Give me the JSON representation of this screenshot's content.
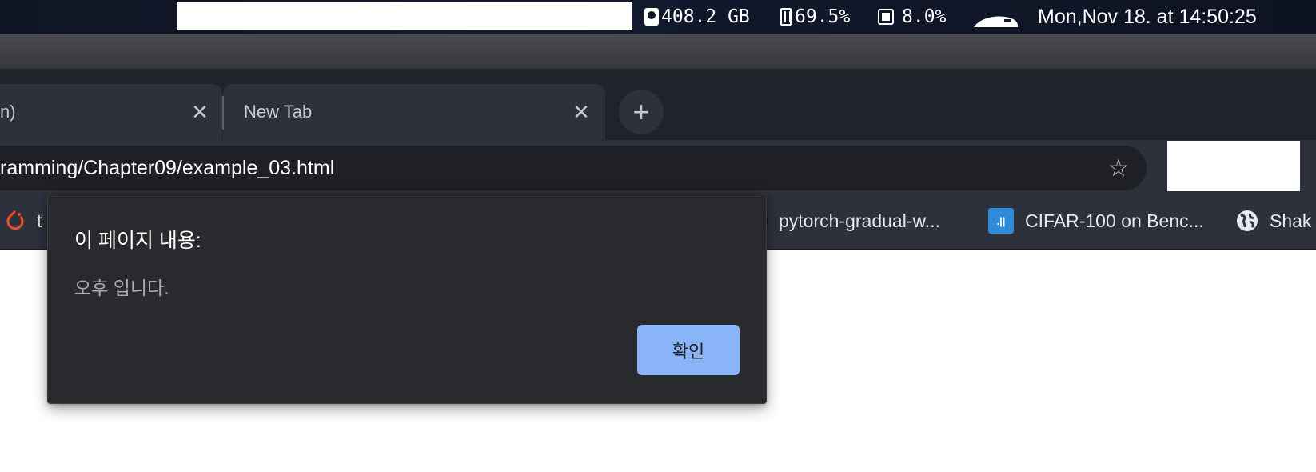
{
  "menubar": {
    "disk": "408.2 GB",
    "memory": "69.5%",
    "cpu": "8.0%",
    "datetime": "Mon,Nov 18. at 14:50:25"
  },
  "tabs": [
    {
      "title": "n)",
      "close": "✕"
    },
    {
      "title": "New Tab",
      "close": "✕"
    }
  ],
  "new_tab_label": "+",
  "address_bar": {
    "url": "ramming/Chapter09/example_03.html",
    "star": "☆"
  },
  "bookmarks": [
    {
      "label": "t",
      "icon": "pytorch-icon"
    },
    {
      "label": "pytorch-gradual-w...",
      "icon": "github-icon"
    },
    {
      "label": "CIFAR-100 on Benc...",
      "icon": "paperswithcode-icon",
      "icon_text": ".||"
    },
    {
      "label": "Shak",
      "icon": "globe-icon"
    }
  ],
  "dialog": {
    "title": "이 페이지 내용:",
    "message": "오후 입니다.",
    "ok_label": "확인"
  },
  "colors": {
    "tabstrip": "#202329",
    "toolbar": "#2d313b",
    "dialog": "#292a2d",
    "ok_button": "#8ab4f8"
  }
}
